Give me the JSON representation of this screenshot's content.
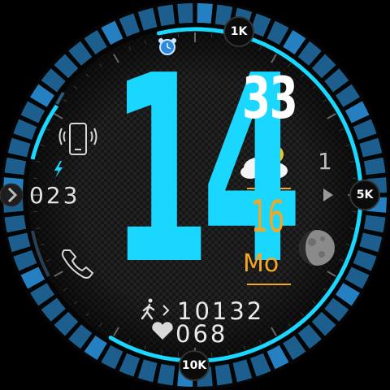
{
  "colors": {
    "accent": "#19d7ff",
    "ring_blue": "#1c6fa8",
    "orange": "#f5a623",
    "white": "#ffffff",
    "bg": "#141414"
  },
  "time": {
    "hour": "14",
    "minute": "33"
  },
  "date": {
    "day": "16",
    "weekday": "Mo"
  },
  "weather_icon": "cloud-sun-icon",
  "alarm_icon": "alarm-clock-icon",
  "left_complications": {
    "phone_icon": "phone-vibrate-icon",
    "charge_icon": "lightning-icon",
    "value": "023",
    "call_icon": "phone-handset-icon"
  },
  "right_complications": {
    "value": "1",
    "moon_icon": "moon-phase-icon"
  },
  "steps": {
    "icon": "walking-icon",
    "value": "10132",
    "progress": 0.62
  },
  "heart": {
    "icon": "heart-icon",
    "value": "068"
  },
  "markers": {
    "top": "1K",
    "right": "5K",
    "bottom": "10K"
  }
}
